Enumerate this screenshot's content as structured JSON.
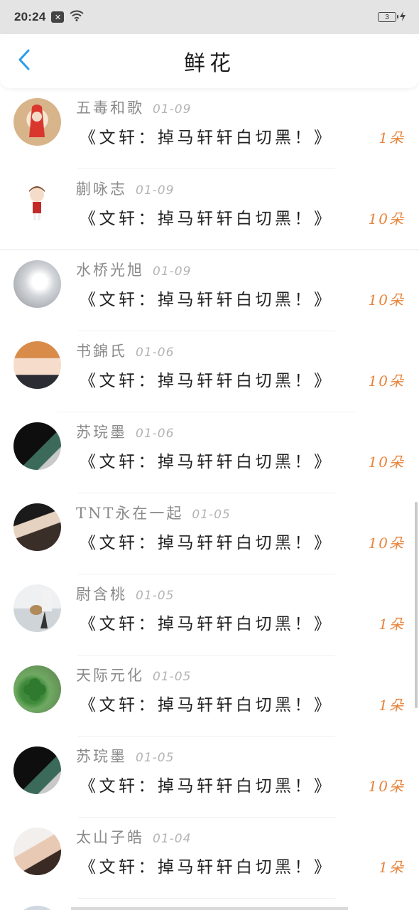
{
  "status_bar": {
    "time": "20:24",
    "battery": "3",
    "icons": [
      "notification-x-icon",
      "wifi-icon",
      "battery-icon",
      "charging-bolt-icon"
    ]
  },
  "header": {
    "back_icon": "chevron-left-icon",
    "title": "鲜花"
  },
  "colors": {
    "accent_back": "#2a9de8",
    "count_orange": "#e8833a",
    "name_gray": "#8a8a8a",
    "date_gray": "#b3b3b3"
  },
  "items": [
    {
      "name": "五毒和歌",
      "date": "01-09",
      "title": "《文轩：掉马轩轩白切黑！》",
      "count": "1朵",
      "avatar": "avatar-red-hair-girl"
    },
    {
      "name": "蒯咏志",
      "date": "01-09",
      "title": "《文轩：掉马轩轩白切黑！》",
      "count": "10朵",
      "avatar": "avatar-chibi-boy"
    },
    {
      "name": "水桥光旭",
      "date": "01-09",
      "title": "《文轩：掉马轩轩白切黑！》",
      "count": "10朵",
      "avatar": "avatar-white-flowers"
    },
    {
      "name": "书錦氏",
      "date": "01-06",
      "title": "《文轩：掉马轩轩白切黑！》",
      "count": "10朵",
      "avatar": "avatar-anime-boy"
    },
    {
      "name": "苏琓墨",
      "date": "01-06",
      "title": "《文轩：掉马轩轩白切黑！》",
      "count": "10朵",
      "avatar": "avatar-dark-photo"
    },
    {
      "name": "TNT永在一起",
      "date": "01-05",
      "title": "《文轩：掉马轩轩白切黑！》",
      "count": "10朵",
      "avatar": "avatar-couple-photo"
    },
    {
      "name": "尉含桃",
      "date": "01-05",
      "title": "《文轩：掉马轩轩白切黑！》",
      "count": "1朵",
      "avatar": "avatar-dancer-photo"
    },
    {
      "name": "天际元化",
      "date": "01-05",
      "title": "《文轩：掉马轩轩白切黑！》",
      "count": "1朵",
      "avatar": "avatar-clover"
    },
    {
      "name": "苏琓墨",
      "date": "01-05",
      "title": "《文轩：掉马轩轩白切黑！》",
      "count": "10朵",
      "avatar": "avatar-dark-photo"
    },
    {
      "name": "太山子皓",
      "date": "01-04",
      "title": "《文轩：掉马轩轩白切黑！》",
      "count": "1朵",
      "avatar": "avatar-portrait"
    }
  ]
}
